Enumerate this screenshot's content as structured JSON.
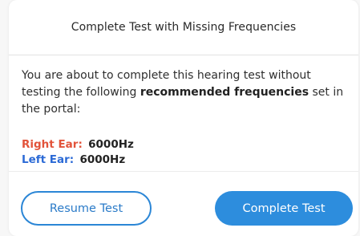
{
  "dialog": {
    "title": "Complete Test with Missing Frequencies",
    "message_part1": "You are about to complete this hearing test without testing the following ",
    "message_bold": "recommended frequencies",
    "message_part2": " set in the portal:",
    "right_ear": {
      "label": "Right Ear:",
      "value": "6000Hz",
      "color": "#e2533a"
    },
    "left_ear": {
      "label": "Left Ear:",
      "value": "6000Hz",
      "color": "#2b6ad6"
    },
    "buttons": {
      "resume_label": "Resume Test",
      "complete_label": "Complete Test",
      "primary_color": "#2d8ddd"
    }
  }
}
